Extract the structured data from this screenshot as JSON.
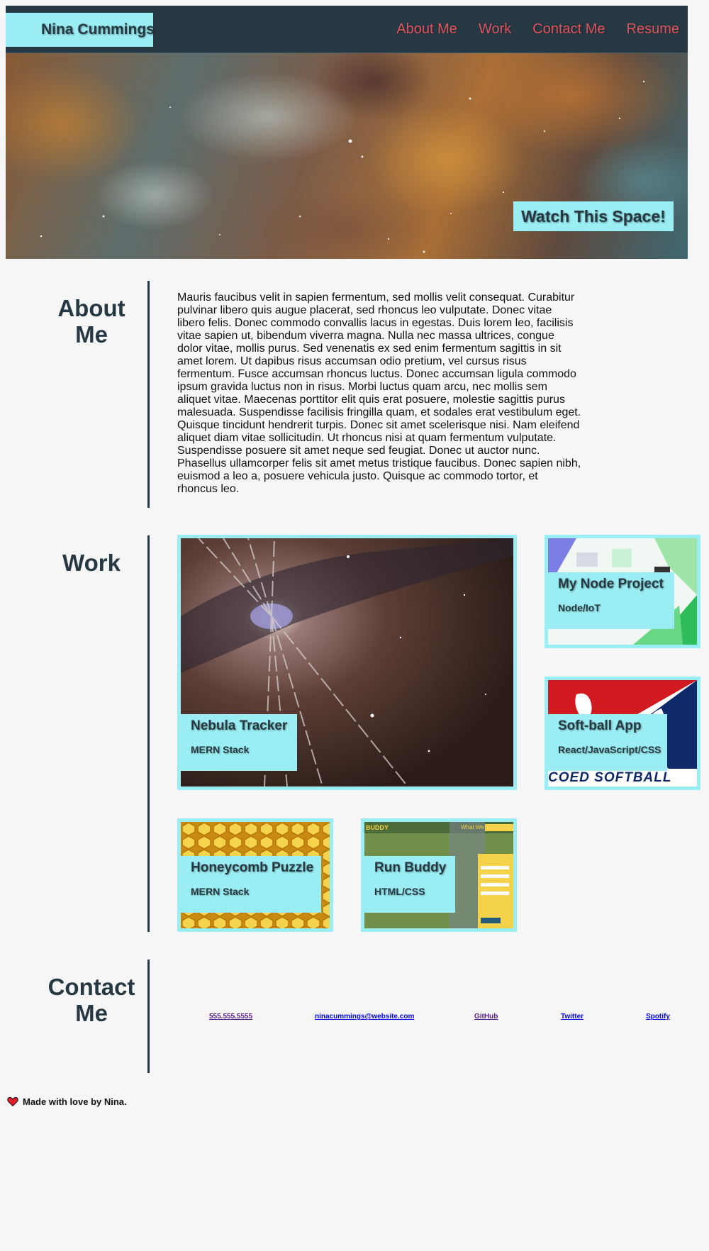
{
  "header": {
    "brand": "Nina Cummings",
    "nav": [
      "About Me",
      "Work",
      "Contact Me",
      "Resume"
    ]
  },
  "hero": {
    "caption": "Watch This Space!"
  },
  "about": {
    "title": "About Me",
    "body": "Mauris faucibus velit in sapien fermentum, sed mollis velit consequat. Curabitur pulvinar libero quis augue placerat, sed rhoncus leo vulputate. Donec vitae libero felis. Donec commodo convallis lacus in egestas. Duis lorem leo, facilisis vitae sapien ut, bibendum viverra magna. Nulla nec massa ultrices, congue dolor vitae, mollis purus. Sed venenatis ex sed enim fermentum sagittis in sit amet lorem. Ut dapibus risus accumsan odio pretium, vel cursus risus fermentum. Fusce accumsan rhoncus luctus. Donec accumsan ligula commodo ipsum gravida luctus non in risus. Morbi luctus quam arcu, nec mollis sem aliquet vitae. Maecenas porttitor elit quis erat posuere, molestie sagittis purus malesuada. Suspendisse facilisis fringilla quam, et sodales erat vestibulum eget. Quisque tincidunt hendrerit turpis. Donec sit amet scelerisque nisi. Nam eleifend aliquet diam vitae sollicitudin. Ut rhoncus nisi at quam fermentum vulputate. Suspendisse posuere sit amet neque sed feugiat. Donec ut auctor nunc. Phasellus ullamcorper felis sit amet metus tristique faucibus. Donec sapien nibh, euismod a leo a, posuere vehicula justo. Quisque ac commodo tortor, et rhoncus leo."
  },
  "work": {
    "title": "Work",
    "projects": [
      {
        "title": "Nebula Tracker",
        "stack": "MERN Stack"
      },
      {
        "title": "My Node Project",
        "stack": "Node/IoT"
      },
      {
        "title": "Soft-ball App",
        "stack": "React/JavaScript/CSS"
      },
      {
        "title": "Honeycomb Puzzle",
        "stack": "MERN Stack"
      },
      {
        "title": "Run Buddy",
        "stack": "HTML/CSS"
      }
    ],
    "softball_banner": "COED SOFTBALL",
    "runbuddy_brand": "BUDDY",
    "runbuddy_nav": "What We Do"
  },
  "contact": {
    "title": "Contact Me",
    "links": [
      "555.555.5555",
      "ninacummings@website.com",
      "GitHub",
      "Twitter",
      "Spotify"
    ]
  },
  "footer": {
    "text": "Made with love by Nina."
  },
  "colors": {
    "navy": "#263943",
    "aqua": "#9aeef3",
    "nav_link": "#e0525d",
    "background": "#f6f6f6"
  }
}
